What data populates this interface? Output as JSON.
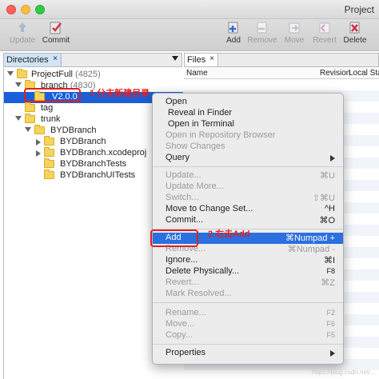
{
  "window": {
    "title": "Project"
  },
  "toolbar": {
    "update": "Update",
    "commit": "Commit",
    "add": "Add",
    "remove": "Remove",
    "move": "Move",
    "revert": "Revert",
    "delete": "Delete"
  },
  "directories": {
    "tab_label": "Directories",
    "close": "×",
    "tree": [
      {
        "label": "ProjectFull",
        "count": "(4825)"
      },
      {
        "label": "branch",
        "count": "(4830)"
      },
      {
        "label": "V2.0.0",
        "count": ""
      },
      {
        "label": "tag",
        "count": ""
      },
      {
        "label": "trunk",
        "count": ""
      },
      {
        "label": "BYDBranch",
        "count": ""
      },
      {
        "label": "BYDBranch",
        "count": ""
      },
      {
        "label": "BYDBranch.xcodeproj",
        "count": ""
      },
      {
        "label": "BYDBranchTests",
        "count": ""
      },
      {
        "label": "BYDBranchUITests",
        "count": ""
      }
    ]
  },
  "files": {
    "tab_label": "Files",
    "close": "×",
    "col_name": "Name",
    "col_revision": "Revision",
    "col_local_status": "Local Stat"
  },
  "annotations": {
    "note1": "1 分支新建目录",
    "note2": "2 右击Add"
  },
  "context_menu": [
    {
      "label": "Open",
      "shortcut": ""
    },
    {
      "label": "Reveal in Finder",
      "shortcut": ""
    },
    {
      "label": "Open in Terminal",
      "shortcut": ""
    },
    {
      "label": "Open in Repository Browser",
      "shortcut": ""
    },
    {
      "label": "Show Changes",
      "shortcut": ""
    },
    {
      "label": "Query",
      "shortcut": ""
    },
    {
      "label": "Update...",
      "shortcut": "⌘U"
    },
    {
      "label": "Update More...",
      "shortcut": ""
    },
    {
      "label": "Switch...",
      "shortcut": "⇧⌘U"
    },
    {
      "label": "Move to Change Set...",
      "shortcut": "^H"
    },
    {
      "label": "Commit...",
      "shortcut": "⌘O"
    },
    {
      "label": "Add",
      "shortcut": "⌘Numpad +"
    },
    {
      "label": "Remove...",
      "shortcut": "⌘Numpad -"
    },
    {
      "label": "Ignore...",
      "shortcut": "⌘I"
    },
    {
      "label": "Delete Physically...",
      "shortcut": "F8"
    },
    {
      "label": "Revert...",
      "shortcut": "⌘Z"
    },
    {
      "label": "Mark Resolved...",
      "shortcut": ""
    },
    {
      "label": "Rename...",
      "shortcut": "F2"
    },
    {
      "label": "Move...",
      "shortcut": "F6"
    },
    {
      "label": "Copy...",
      "shortcut": "F5"
    },
    {
      "label": "Properties",
      "shortcut": ""
    }
  ],
  "watermark": "https://blog.csdn.net/..."
}
